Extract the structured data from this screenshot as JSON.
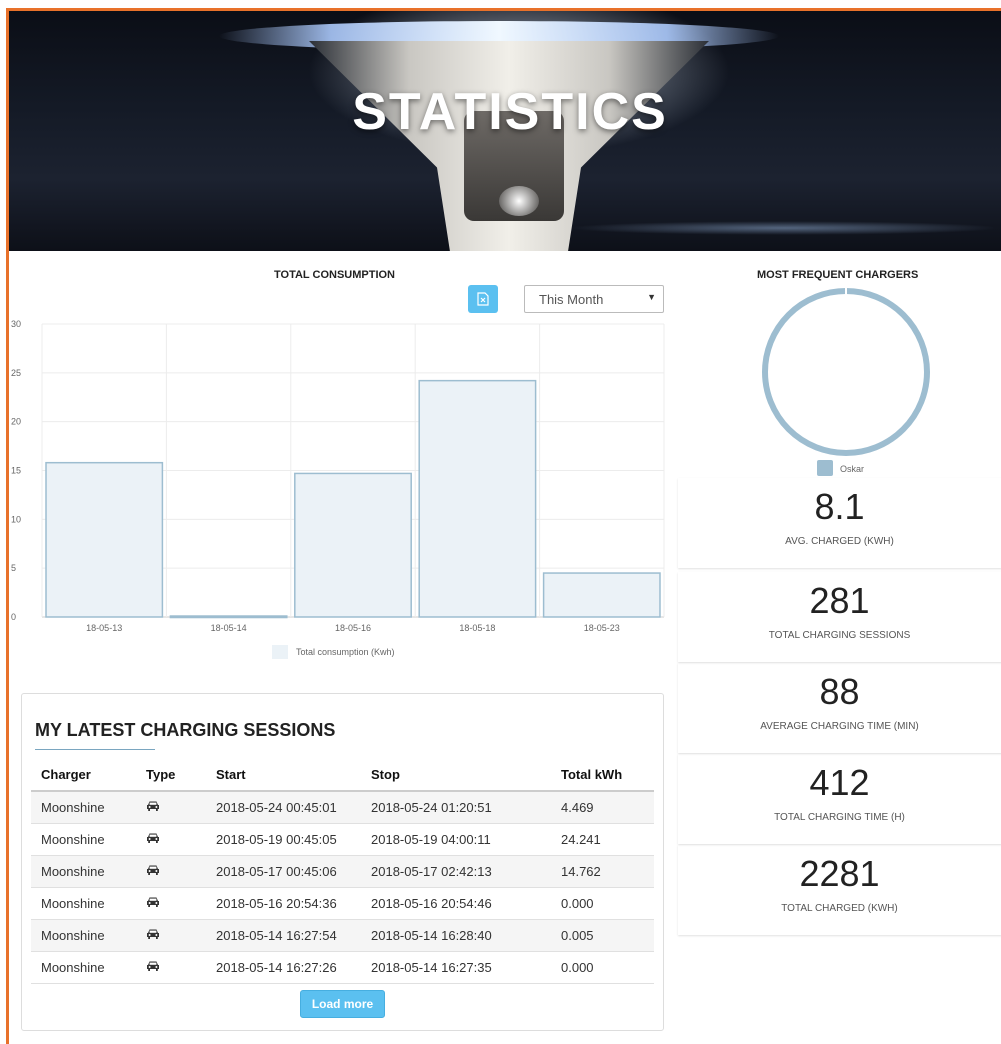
{
  "hero": {
    "title": "STATISTICS"
  },
  "consumption": {
    "title": "TOTAL CONSUMPTION",
    "export_icon": "excel-export-icon",
    "period_select": {
      "selected": "This Month"
    }
  },
  "chart_data": {
    "type": "bar",
    "categories": [
      "18-05-13",
      "18-05-14",
      "18-05-16",
      "18-05-18",
      "18-05-23"
    ],
    "series": [
      {
        "name": "Total consumption (Kwh)",
        "values": [
          15.8,
          0.1,
          14.7,
          24.2,
          4.5
        ]
      }
    ],
    "ylim": [
      0,
      30
    ],
    "yticks": [
      0,
      5,
      10,
      15,
      20,
      25,
      30
    ],
    "grid": true,
    "legend": "bottom",
    "bar_fill": "#ebf2f7",
    "bar_stroke": "#9dbdd0"
  },
  "frequent": {
    "title": "MOST FREQUENT CHARGERS",
    "donut": [
      {
        "name": "Oskar",
        "value": 1
      }
    ],
    "color": "#9dbdd0"
  },
  "stats": [
    {
      "value": "8.1",
      "label": "AVG. CHARGED (KWH)"
    },
    {
      "value": "281",
      "label": "TOTAL CHARGING SESSIONS"
    },
    {
      "value": "88",
      "label": "AVERAGE CHARGING TIME (MIN)"
    },
    {
      "value": "412",
      "label": "TOTAL CHARGING TIME (H)"
    },
    {
      "value": "2281",
      "label": "TOTAL CHARGED (KWH)"
    }
  ],
  "sessions": {
    "title": "MY LATEST CHARGING SESSIONS",
    "columns": [
      "Charger",
      "Type",
      "Start",
      "Stop",
      "Total kWh"
    ],
    "type_icon": "car-icon",
    "rows": [
      {
        "charger": "Moonshine",
        "start": "2018-05-24 00:45:01",
        "stop": "2018-05-24 01:20:51",
        "kwh": "4.469"
      },
      {
        "charger": "Moonshine",
        "start": "2018-05-19 00:45:05",
        "stop": "2018-05-19 04:00:11",
        "kwh": "24.241"
      },
      {
        "charger": "Moonshine",
        "start": "2018-05-17 00:45:06",
        "stop": "2018-05-17 02:42:13",
        "kwh": "14.762"
      },
      {
        "charger": "Moonshine",
        "start": "2018-05-16 20:54:36",
        "stop": "2018-05-16 20:54:46",
        "kwh": "0.000"
      },
      {
        "charger": "Moonshine",
        "start": "2018-05-14 16:27:54",
        "stop": "2018-05-14 16:28:40",
        "kwh": "0.005"
      },
      {
        "charger": "Moonshine",
        "start": "2018-05-14 16:27:26",
        "stop": "2018-05-14 16:27:35",
        "kwh": "0.000"
      }
    ],
    "load_more": "Load more"
  },
  "colors": {
    "accent": "#5bc0f0",
    "frame": "#e8712a"
  }
}
